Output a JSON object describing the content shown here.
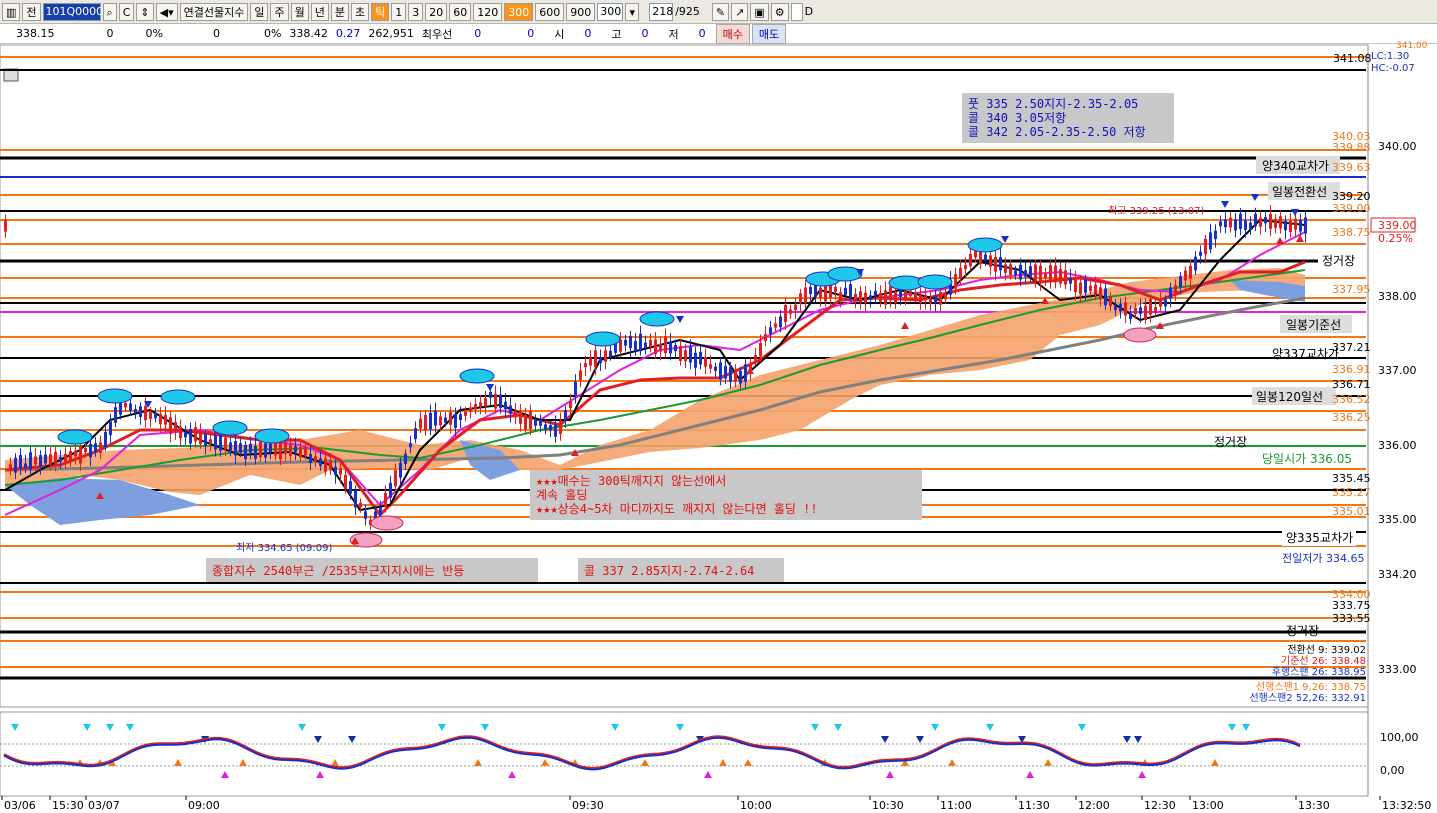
{
  "toolbar": {
    "code_value": "101Q0000",
    "items": [
      "전",
      "연결선물지수",
      "일",
      "주",
      "월",
      "년",
      "분",
      "초",
      "틱",
      "1",
      "3",
      "20",
      "60",
      "120",
      "300",
      "600",
      "900"
    ],
    "active_item": "300",
    "interval_value": "300",
    "count_value": "218",
    "count_total": "/925",
    "checkbox_label": "D"
  },
  "info": {
    "v1": "338.15",
    "v2": "0",
    "v3": "0%",
    "v4": "0",
    "v5": "0%",
    "v6": "338.42",
    "v7": "0.27",
    "v8": "262,951",
    "v9": "최우선",
    "v10": "0",
    "v11": "0",
    "v12": "시",
    "v13": "0",
    "v14": "고",
    "v15": "0",
    "v16": "저",
    "v17": "0",
    "buy": "매수",
    "sell": "매도"
  },
  "colors": {
    "orange": "#f07818",
    "magenta": "#e020e0",
    "red": "#e02020",
    "blue": "#1830c8",
    "green": "#1a9a30",
    "gray": "#808080",
    "cloud": "#f5a36b",
    "cloud_blue": "#7d9fe0"
  },
  "price_axis": {
    "labels": [
      "341.08",
      "340.03",
      "339.88",
      "340.00",
      "339.63",
      "339.20",
      "339.00",
      "338.75",
      "338.00",
      "337.95",
      "337.21",
      "337.00",
      "336.91",
      "336.71",
      "336.52",
      "336.25",
      "336.00",
      "335.45",
      "335.27",
      "335.01",
      "335.00",
      "334.20",
      "334.00",
      "333.75",
      "333.55",
      "333.00"
    ],
    "current": "339.00",
    "current_pct": "0.25%",
    "lc": "LC:1.30",
    "hc": "HC:-0.07",
    "top_cut": "341.00"
  },
  "right_labels": {
    "yang340": "양340교차가",
    "ilbong_jeonhwan": "일봉전환선",
    "jeonggeojang1": "정거장",
    "ilbong_gijun": "일봉기준선",
    "yang337": "양337교차가",
    "ilbong120": "일봉120일선",
    "jeonggeojang2": "정거장",
    "dangil": "당일시가 336.05",
    "yang335": "양335교차가",
    "jeonil": "전일저가 334.65",
    "jeonggeojang3": "정거장",
    "legend1": "전환선 9: 339.02",
    "legend2": "기준선 26: 338.48",
    "legend3": "후행스팬 26: 338.95",
    "legend4": "선행스팬1 9,26: 338.75",
    "legend5": "선행스팬2 52,26: 332.91"
  },
  "annotations": {
    "box_top_1": "풋 335 2.50지지-2.35-2.05",
    "box_top_2": "콜 340 3.05저항",
    "box_top_3": "콜 342 2.05-2.35-2.50 저항",
    "box_mid_1": "★★★매수는 300틱깨지지 않는선에서",
    "box_mid_2": "계속 홀딩",
    "box_mid_3": "★★★상승4~5차 마디까지도 깨지지 않는다면 홀딩 !!",
    "box_low_left": "종합지수 2540부근 /2535부근지지시에는 반등",
    "box_low_right": "콜 337 2.85지지-2.74-2.64",
    "high_label": "최고 339.25 (13:07)",
    "low_label": "최저 334.65 (09:09)"
  },
  "osc_axis": {
    "l1": "100,00",
    "l2": "0,00"
  },
  "time_axis": [
    "03/06",
    "15:30",
    "03/07",
    "09:00",
    "09:30",
    "10:00",
    "10:30",
    "11:00",
    "11:30",
    "12:00",
    "12:30",
    "13:00",
    "13:30",
    "13:32:50"
  ]
}
